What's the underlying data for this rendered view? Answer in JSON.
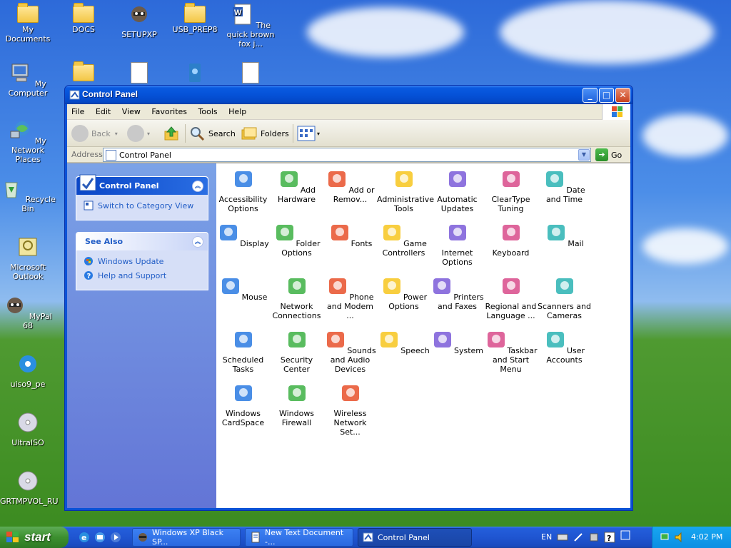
{
  "desktop": {
    "icons": [
      {
        "label": "My Documents"
      },
      {
        "label": "DOCS"
      },
      {
        "label": "SETUPXP"
      },
      {
        "label": "USB_PREP8"
      },
      {
        "label": "The quick brown fox j..."
      },
      {
        "label": "My Computer"
      },
      {
        "label": "My Network Places"
      },
      {
        "label": "Recycle Bin"
      },
      {
        "label": "Microsoft Outlook"
      },
      {
        "label": "MyPal 68"
      },
      {
        "label": "uiso9_pe"
      },
      {
        "label": "UltraISO"
      },
      {
        "label": "GRTMPVOL_RU"
      }
    ]
  },
  "window": {
    "title": "Control Panel",
    "menu": [
      "File",
      "Edit",
      "View",
      "Favorites",
      "Tools",
      "Help"
    ],
    "toolbar": {
      "back": "Back",
      "search": "Search",
      "folders": "Folders"
    },
    "address": {
      "label": "Address",
      "value": "Control Panel",
      "go": "Go"
    },
    "taskpane": {
      "control_panel": {
        "title": "Control Panel",
        "link": "Switch to Category View"
      },
      "see_also": {
        "title": "See Also",
        "links": [
          "Windows Update",
          "Help and Support"
        ]
      }
    },
    "items": [
      {
        "label": "Accessibility Options",
        "icon": "accessibility-icon"
      },
      {
        "label": "Add Hardware",
        "icon": "hardware-icon"
      },
      {
        "label": "Add or Remov...",
        "icon": "add-remove-icon"
      },
      {
        "label": "Administrative Tools",
        "icon": "admin-tools-icon"
      },
      {
        "label": "Automatic Updates",
        "icon": "updates-icon"
      },
      {
        "label": "ClearType Tuning",
        "icon": "cleartype-icon"
      },
      {
        "label": "Date and Time",
        "icon": "clock-icon"
      },
      {
        "label": "Display",
        "icon": "display-icon"
      },
      {
        "label": "Folder Options",
        "icon": "folder-icon"
      },
      {
        "label": "Fonts",
        "icon": "fonts-icon"
      },
      {
        "label": "Game Controllers",
        "icon": "gamepad-icon"
      },
      {
        "label": "Internet Options",
        "icon": "globe-icon"
      },
      {
        "label": "Keyboard",
        "icon": "keyboard-icon"
      },
      {
        "label": "Mail",
        "icon": "mail-icon"
      },
      {
        "label": "Mouse",
        "icon": "mouse-icon"
      },
      {
        "label": "Network Connections",
        "icon": "network-icon"
      },
      {
        "label": "Phone and Modem ...",
        "icon": "phone-icon"
      },
      {
        "label": "Power Options",
        "icon": "power-icon"
      },
      {
        "label": "Printers and Faxes",
        "icon": "printer-icon"
      },
      {
        "label": "Regional and Language ...",
        "icon": "regional-icon"
      },
      {
        "label": "Scanners and Cameras",
        "icon": "scanner-icon"
      },
      {
        "label": "Scheduled Tasks",
        "icon": "scheduled-icon"
      },
      {
        "label": "Security Center",
        "icon": "shield-icon"
      },
      {
        "label": "Sounds and Audio Devices",
        "icon": "speaker-icon"
      },
      {
        "label": "Speech",
        "icon": "speech-icon"
      },
      {
        "label": "System",
        "icon": "system-icon"
      },
      {
        "label": "Taskbar and Start Menu",
        "icon": "taskbar-icon"
      },
      {
        "label": "User Accounts",
        "icon": "users-icon"
      },
      {
        "label": "Windows CardSpace",
        "icon": "cardspace-icon"
      },
      {
        "label": "Windows Firewall",
        "icon": "firewall-icon"
      },
      {
        "label": "Wireless Network Set...",
        "icon": "wireless-icon"
      }
    ]
  },
  "taskbar": {
    "start": "start",
    "tasks": [
      {
        "label": "Windows XP Black SP..."
      },
      {
        "label": "New Text Document -..."
      },
      {
        "label": "Control Panel"
      }
    ],
    "language": "EN",
    "clock": "4:02 PM"
  }
}
